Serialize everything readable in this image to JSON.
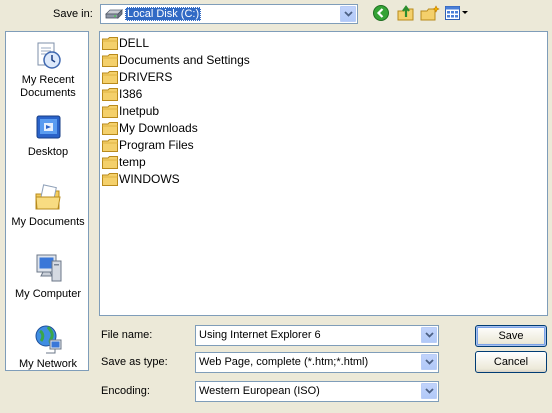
{
  "save_in": {
    "label": "Save in:",
    "value": "Local Disk (C:)"
  },
  "toolbar": {
    "back_icon": "back-icon",
    "up_icon": "up-folder-icon",
    "new_folder_icon": "new-folder-icon",
    "views_icon": "views-menu-icon"
  },
  "places": [
    {
      "label": "My Recent\nDocuments",
      "icon": "recent-documents-icon"
    },
    {
      "label": "Desktop",
      "icon": "desktop-icon"
    },
    {
      "label": "My Documents",
      "icon": "my-documents-icon"
    },
    {
      "label": "My Computer",
      "icon": "my-computer-icon"
    },
    {
      "label": "My Network",
      "icon": "my-network-icon"
    }
  ],
  "files": [
    "DELL",
    "Documents and Settings",
    "DRIVERS",
    "I386",
    "Inetpub",
    "My Downloads",
    "Program Files",
    "temp",
    "WINDOWS"
  ],
  "form": {
    "file_name_label": "File name:",
    "file_name_value": "Using Internet Explorer 6",
    "save_type_label": "Save as type:",
    "save_type_value": "Web Page, complete (*.htm;*.html)",
    "encoding_label": "Encoding:",
    "encoding_value": "Western European (ISO)"
  },
  "buttons": {
    "save": "Save",
    "cancel": "Cancel"
  },
  "colors": {
    "selection": "#316ac5",
    "border": "#7f9db9",
    "face": "#ece9d8"
  }
}
